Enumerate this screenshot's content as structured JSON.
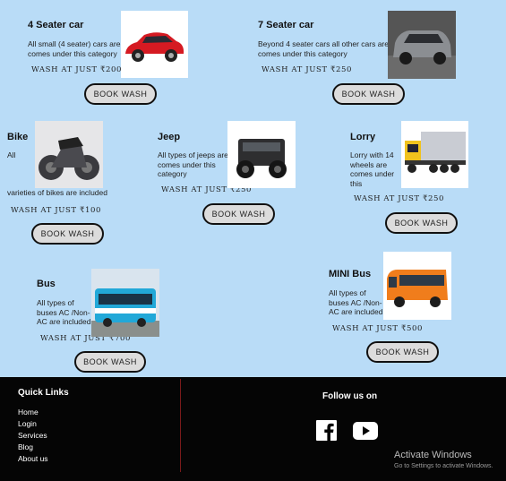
{
  "cards": [
    {
      "title": "4 Seater car",
      "desc": "All small (4 seater) cars are comes under this category",
      "price": "WASH AT JUST ₹200",
      "button": "BOOK WASH"
    },
    {
      "title": "7 Seater car",
      "desc": "Beyond 4 seater cars all other cars are comes under this category",
      "price": "WASH AT JUST ₹250",
      "button": "BOOK WASH"
    },
    {
      "title": "Bike",
      "desc_top": "All",
      "desc_bottom": "varieties of bikes are included",
      "price": "WASH AT JUST ₹100",
      "button": "BOOK WASH"
    },
    {
      "title": "Jeep",
      "desc": "All types of jeeps are comes under this category",
      "price": "WASH AT JUST ₹250",
      "button": "BOOK WASH"
    },
    {
      "title": "Lorry",
      "desc": "Lorry with 14 wheels are comes under this",
      "price": "WASH AT JUST ₹250",
      "button": "BOOK WASH"
    },
    {
      "title": "Bus",
      "desc": "All types of buses AC /Non-AC are included",
      "price": "WASH AT JUST ₹700",
      "button": "BOOK WASH"
    },
    {
      "title": "MINI Bus",
      "desc": "All types of buses AC /Non-AC are included",
      "price": "WASH AT JUST ₹500",
      "button": "BOOK WASH"
    }
  ],
  "footer": {
    "quick_links_title": "Quick Links",
    "links": [
      "Home",
      "Login",
      "Services",
      "Blog",
      "About us"
    ],
    "follow_title": "Follow us on",
    "social_icons": [
      "facebook-icon",
      "youtube-icon"
    ]
  },
  "watermark": {
    "title": "Activate Windows",
    "subtitle": "Go to Settings to activate Windows."
  },
  "colors": {
    "page_background": "#b9dcf7",
    "footer_background": "#050505",
    "button_background": "#dcdcdc"
  }
}
